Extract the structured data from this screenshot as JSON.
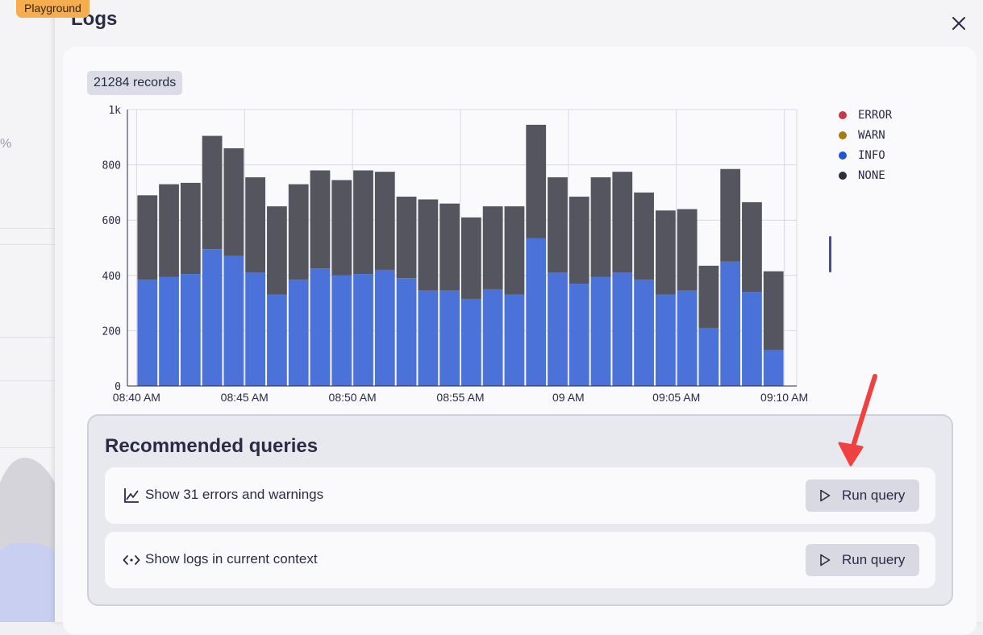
{
  "app_badge": "Playground",
  "panel": {
    "title": "Logs"
  },
  "records_label": "21284 records",
  "legend": [
    {
      "label": "ERROR",
      "color": "#c8374a"
    },
    {
      "label": "WARN",
      "color": "#a77a12"
    },
    {
      "label": "INFO",
      "color": "#1e56d3"
    },
    {
      "label": "NONE",
      "color": "#2d2f3e"
    }
  ],
  "chart_data": {
    "type": "bar",
    "stacked": true,
    "x_ticks": [
      "08:40 AM",
      "08:45 AM",
      "08:50 AM",
      "08:55 AM",
      "09 AM",
      "09:05 AM",
      "09:10 AM"
    ],
    "y_ticks": [
      "0",
      "200",
      "400",
      "600",
      "800",
      "1k"
    ],
    "ylim": [
      0,
      1000
    ],
    "bins_per_tick": 5,
    "series": [
      {
        "name": "INFO",
        "color": "#4a72d8",
        "values": [
          385,
          395,
          405,
          495,
          470,
          410,
          330,
          385,
          425,
          400,
          405,
          420,
          390,
          345,
          345,
          315,
          350,
          330,
          535,
          410,
          370,
          395,
          410,
          385,
          330,
          345,
          210,
          450,
          340,
          130
        ]
      },
      {
        "name": "NONE",
        "color": "#54555f",
        "values": [
          305,
          335,
          330,
          410,
          390,
          345,
          320,
          345,
          355,
          345,
          375,
          355,
          295,
          330,
          315,
          295,
          300,
          320,
          410,
          345,
          315,
          360,
          365,
          315,
          305,
          295,
          225,
          335,
          325,
          285
        ]
      }
    ]
  },
  "recommended": {
    "title": "Recommended queries",
    "queries": [
      {
        "icon": "line-chart-icon",
        "label": "Show 31 errors and warnings",
        "button": "Run query"
      },
      {
        "icon": "code-dots-icon",
        "label": "Show logs in current context",
        "button": "Run query"
      }
    ]
  },
  "arrow_color": "#f04040"
}
